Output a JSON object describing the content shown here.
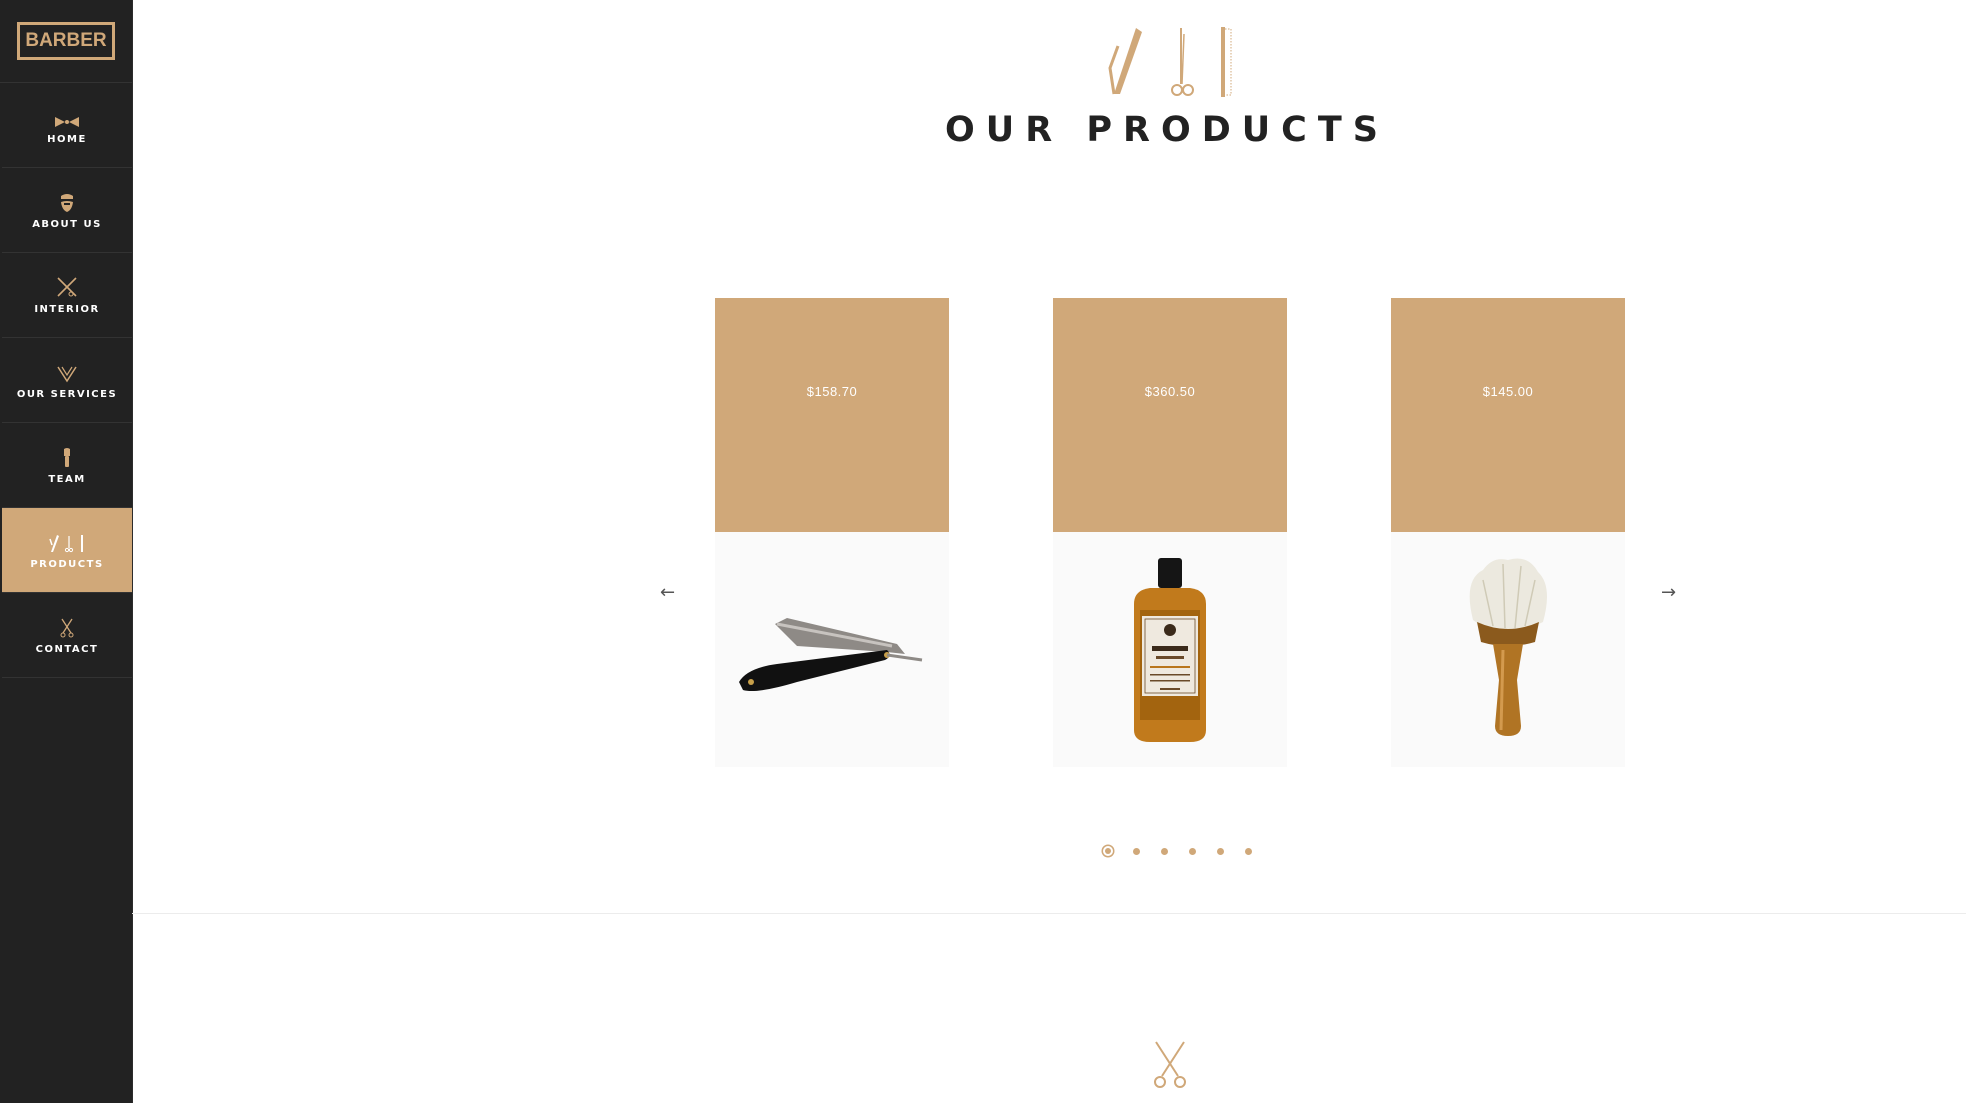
{
  "brand": {
    "logo_text": "BARBER",
    "accent_color": "#d0a879"
  },
  "sidebar": {
    "items": [
      {
        "label": "HOME",
        "icon": "bowtie-icon"
      },
      {
        "label": "ABOUT US",
        "icon": "beard-icon"
      },
      {
        "label": "INTERIOR",
        "icon": "crossed-razor-scissors-icon"
      },
      {
        "label": "OUR SERVICES",
        "icon": "services-icon"
      },
      {
        "label": "TEAM",
        "icon": "shaving-brush-icon"
      },
      {
        "label": "PRODUCTS",
        "icon": "products-icon",
        "active": true
      },
      {
        "label": "CONTACT",
        "icon": "scissors-icon"
      }
    ]
  },
  "section": {
    "title": "OUR PRODUCTS",
    "icon": "razor-scissors-comb-icon"
  },
  "products": [
    {
      "price": "$158.70",
      "image": "straight-razor"
    },
    {
      "price": "$360.50",
      "image": "shampoo-bottle"
    },
    {
      "price": "$145.00",
      "image": "shaving-brush"
    }
  ],
  "carousel": {
    "prev_label": "←",
    "next_label": "→",
    "page_count": 6,
    "active_page": 1
  },
  "next_section": {
    "icon": "scissors-icon"
  }
}
